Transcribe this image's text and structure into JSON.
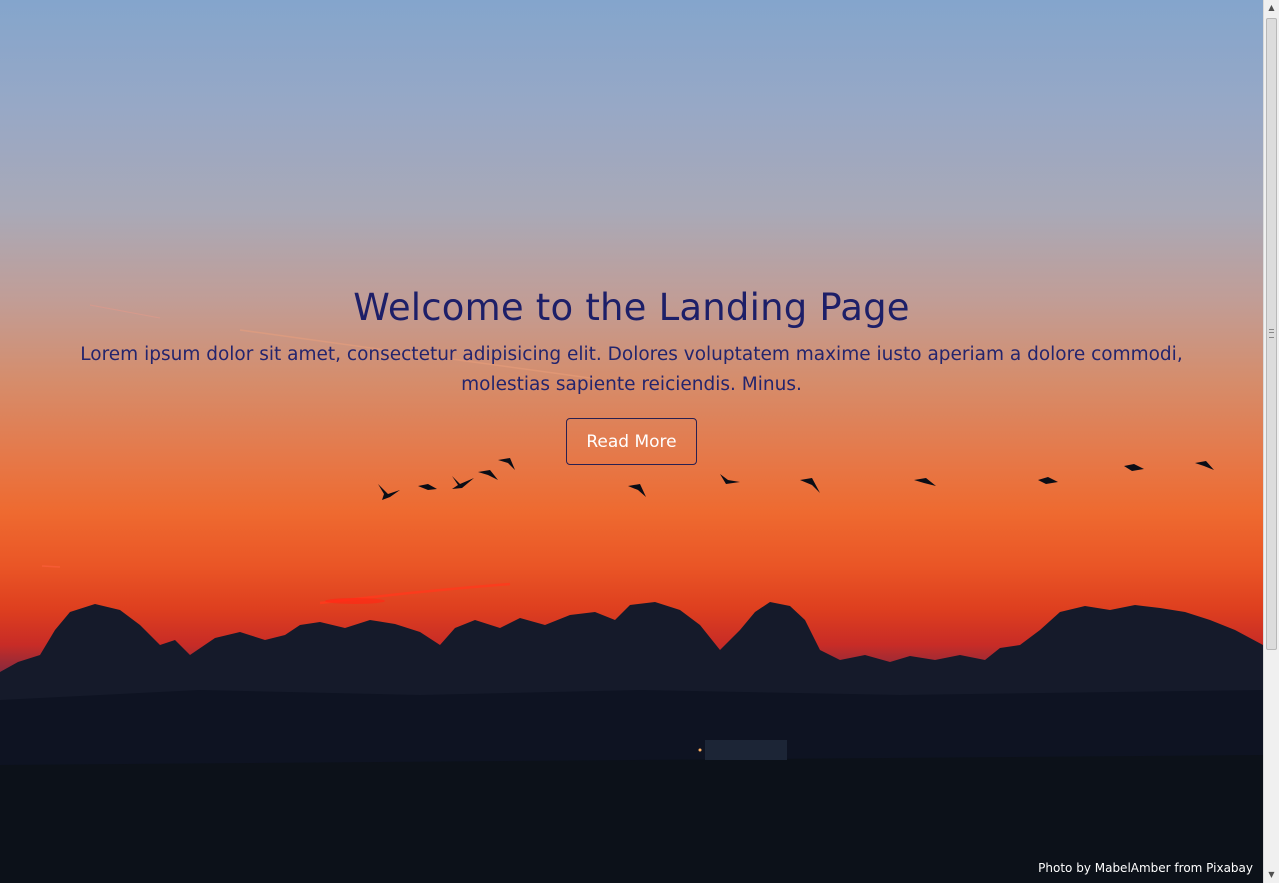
{
  "hero": {
    "title": "Welcome to the Landing Page",
    "lead": "Lorem ipsum dolor sit amet, consectetur adipisicing elit. Dolores voluptatem maxime iusto aperiam a dolore commodi, molestias sapiente reiciendis. Minus.",
    "button_label": "Read More"
  },
  "credit": "Photo by MabelAmber from Pixabay",
  "colors": {
    "heading": "#1d1f68",
    "sky_top": "#84a5cc",
    "sky_sunset": "#ee6a30",
    "horizon": "#c82c26",
    "ground": "#0b101a"
  },
  "scrollbar": {
    "up_icon": "scroll-up-arrow-icon",
    "down_icon": "scroll-down-arrow-icon"
  }
}
